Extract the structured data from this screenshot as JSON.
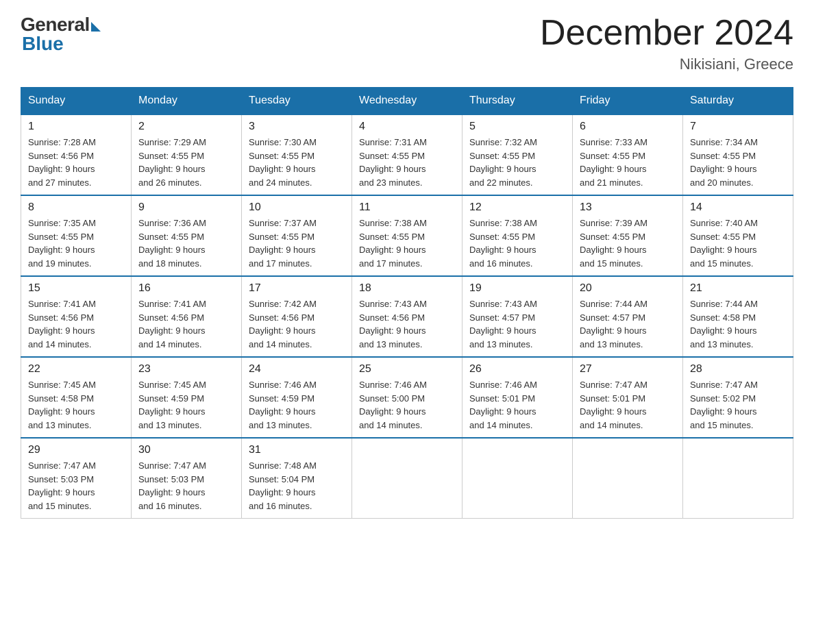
{
  "header": {
    "logo_general": "General",
    "logo_blue": "Blue",
    "month_title": "December 2024",
    "location": "Nikisiani, Greece"
  },
  "days_of_week": [
    "Sunday",
    "Monday",
    "Tuesday",
    "Wednesday",
    "Thursday",
    "Friday",
    "Saturday"
  ],
  "weeks": [
    [
      {
        "day": "1",
        "sunrise": "7:28 AM",
        "sunset": "4:56 PM",
        "daylight": "9 hours and 27 minutes."
      },
      {
        "day": "2",
        "sunrise": "7:29 AM",
        "sunset": "4:55 PM",
        "daylight": "9 hours and 26 minutes."
      },
      {
        "day": "3",
        "sunrise": "7:30 AM",
        "sunset": "4:55 PM",
        "daylight": "9 hours and 24 minutes."
      },
      {
        "day": "4",
        "sunrise": "7:31 AM",
        "sunset": "4:55 PM",
        "daylight": "9 hours and 23 minutes."
      },
      {
        "day": "5",
        "sunrise": "7:32 AM",
        "sunset": "4:55 PM",
        "daylight": "9 hours and 22 minutes."
      },
      {
        "day": "6",
        "sunrise": "7:33 AM",
        "sunset": "4:55 PM",
        "daylight": "9 hours and 21 minutes."
      },
      {
        "day": "7",
        "sunrise": "7:34 AM",
        "sunset": "4:55 PM",
        "daylight": "9 hours and 20 minutes."
      }
    ],
    [
      {
        "day": "8",
        "sunrise": "7:35 AM",
        "sunset": "4:55 PM",
        "daylight": "9 hours and 19 minutes."
      },
      {
        "day": "9",
        "sunrise": "7:36 AM",
        "sunset": "4:55 PM",
        "daylight": "9 hours and 18 minutes."
      },
      {
        "day": "10",
        "sunrise": "7:37 AM",
        "sunset": "4:55 PM",
        "daylight": "9 hours and 17 minutes."
      },
      {
        "day": "11",
        "sunrise": "7:38 AM",
        "sunset": "4:55 PM",
        "daylight": "9 hours and 17 minutes."
      },
      {
        "day": "12",
        "sunrise": "7:38 AM",
        "sunset": "4:55 PM",
        "daylight": "9 hours and 16 minutes."
      },
      {
        "day": "13",
        "sunrise": "7:39 AM",
        "sunset": "4:55 PM",
        "daylight": "9 hours and 15 minutes."
      },
      {
        "day": "14",
        "sunrise": "7:40 AM",
        "sunset": "4:55 PM",
        "daylight": "9 hours and 15 minutes."
      }
    ],
    [
      {
        "day": "15",
        "sunrise": "7:41 AM",
        "sunset": "4:56 PM",
        "daylight": "9 hours and 14 minutes."
      },
      {
        "day": "16",
        "sunrise": "7:41 AM",
        "sunset": "4:56 PM",
        "daylight": "9 hours and 14 minutes."
      },
      {
        "day": "17",
        "sunrise": "7:42 AM",
        "sunset": "4:56 PM",
        "daylight": "9 hours and 14 minutes."
      },
      {
        "day": "18",
        "sunrise": "7:43 AM",
        "sunset": "4:56 PM",
        "daylight": "9 hours and 13 minutes."
      },
      {
        "day": "19",
        "sunrise": "7:43 AM",
        "sunset": "4:57 PM",
        "daylight": "9 hours and 13 minutes."
      },
      {
        "day": "20",
        "sunrise": "7:44 AM",
        "sunset": "4:57 PM",
        "daylight": "9 hours and 13 minutes."
      },
      {
        "day": "21",
        "sunrise": "7:44 AM",
        "sunset": "4:58 PM",
        "daylight": "9 hours and 13 minutes."
      }
    ],
    [
      {
        "day": "22",
        "sunrise": "7:45 AM",
        "sunset": "4:58 PM",
        "daylight": "9 hours and 13 minutes."
      },
      {
        "day": "23",
        "sunrise": "7:45 AM",
        "sunset": "4:59 PM",
        "daylight": "9 hours and 13 minutes."
      },
      {
        "day": "24",
        "sunrise": "7:46 AM",
        "sunset": "4:59 PM",
        "daylight": "9 hours and 13 minutes."
      },
      {
        "day": "25",
        "sunrise": "7:46 AM",
        "sunset": "5:00 PM",
        "daylight": "9 hours and 14 minutes."
      },
      {
        "day": "26",
        "sunrise": "7:46 AM",
        "sunset": "5:01 PM",
        "daylight": "9 hours and 14 minutes."
      },
      {
        "day": "27",
        "sunrise": "7:47 AM",
        "sunset": "5:01 PM",
        "daylight": "9 hours and 14 minutes."
      },
      {
        "day": "28",
        "sunrise": "7:47 AM",
        "sunset": "5:02 PM",
        "daylight": "9 hours and 15 minutes."
      }
    ],
    [
      {
        "day": "29",
        "sunrise": "7:47 AM",
        "sunset": "5:03 PM",
        "daylight": "9 hours and 15 minutes."
      },
      {
        "day": "30",
        "sunrise": "7:47 AM",
        "sunset": "5:03 PM",
        "daylight": "9 hours and 16 minutes."
      },
      {
        "day": "31",
        "sunrise": "7:48 AM",
        "sunset": "5:04 PM",
        "daylight": "9 hours and 16 minutes."
      },
      null,
      null,
      null,
      null
    ]
  ],
  "labels": {
    "sunrise": "Sunrise:",
    "sunset": "Sunset:",
    "daylight": "Daylight:"
  }
}
